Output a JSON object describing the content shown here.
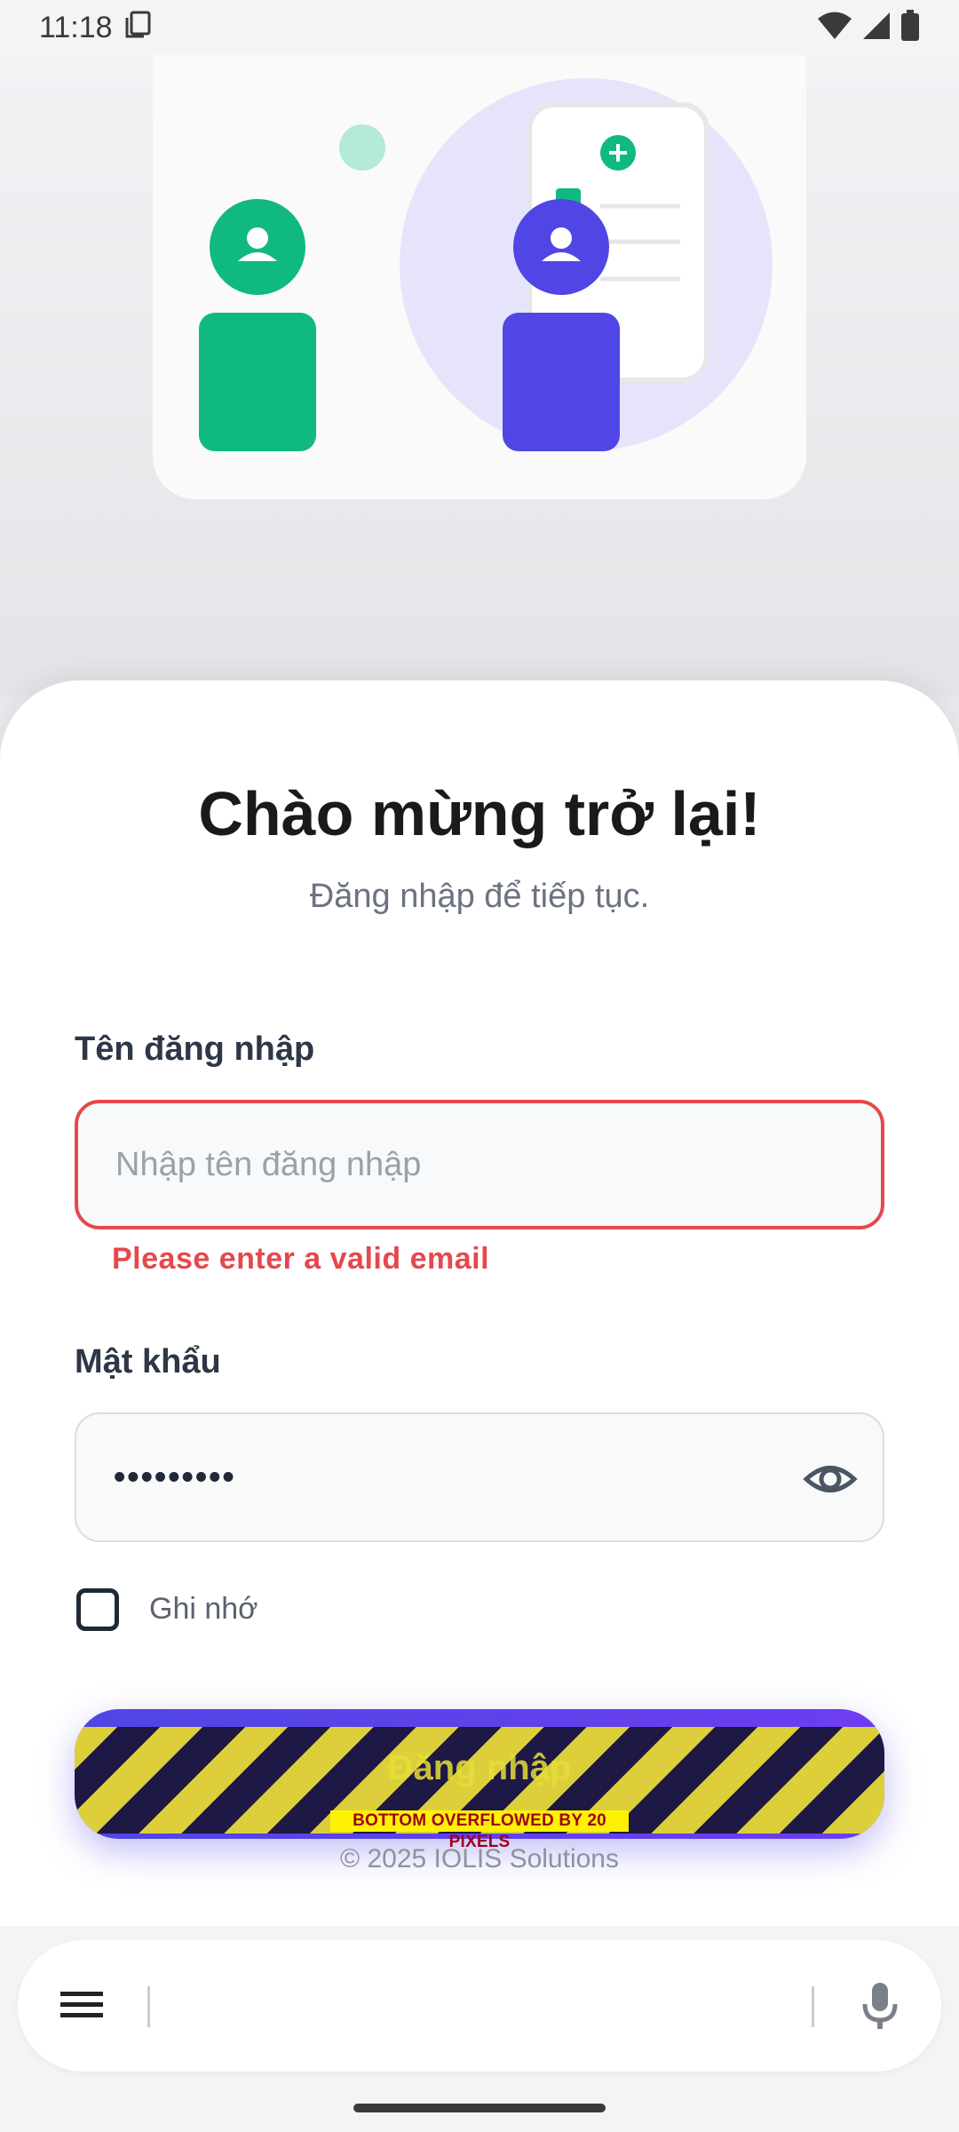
{
  "status_bar": {
    "time": "11:18"
  },
  "header": {
    "title": "Chào mừng trở lại!",
    "subtitle": "Đăng nhập để tiếp tục."
  },
  "username": {
    "label": "Tên đăng nhập",
    "placeholder": "Nhập tên đăng nhập",
    "value": "",
    "error": "Please enter a valid email"
  },
  "password": {
    "label": "Mật khẩu",
    "value": "•••••••••"
  },
  "remember": {
    "label": "Ghi nhớ",
    "checked": false
  },
  "login_button": {
    "label": "Đăng nhập"
  },
  "overflow_warning": "BOTTOM OVERFLOWED BY 20 PIXELS",
  "footer": {
    "copyright": "© 2025 IOLIS Solutions"
  },
  "colors": {
    "primary": "#4f46e5",
    "secondary": "#10b981",
    "error": "#e5484d"
  },
  "icons": [
    "screenshot-icon",
    "wifi-icon",
    "signal-icon",
    "battery-icon",
    "eye-icon",
    "menu-icon",
    "mic-icon",
    "user-icon",
    "plus-icon"
  ]
}
